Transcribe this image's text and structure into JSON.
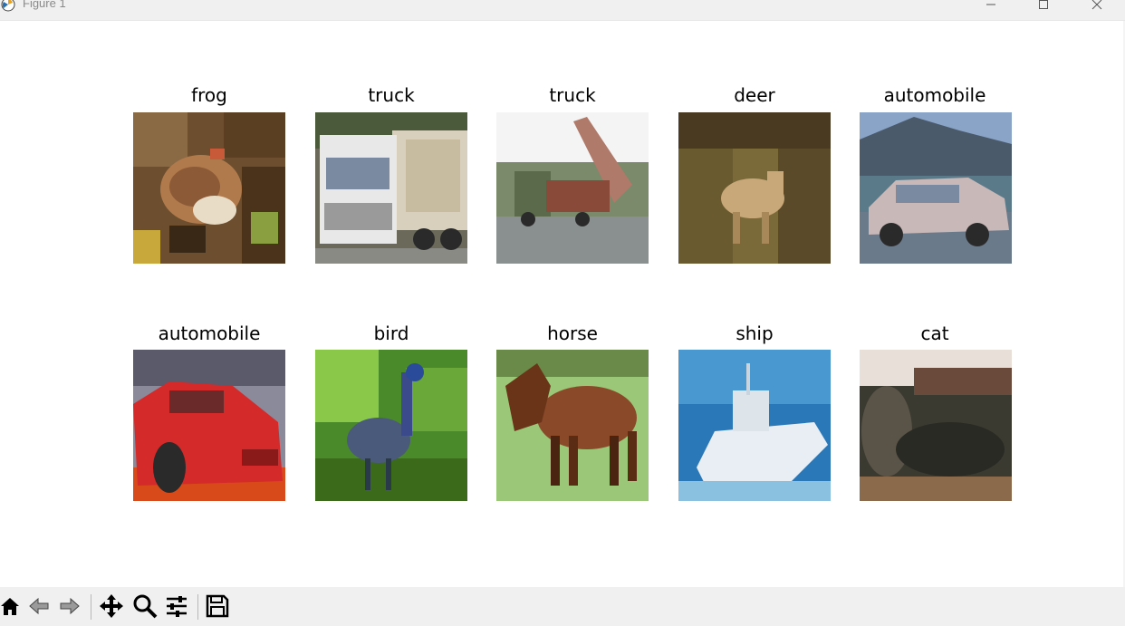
{
  "window": {
    "title": "Figure 1",
    "controls": [
      "minimize",
      "maximize",
      "close"
    ]
  },
  "figure": {
    "panels": [
      {
        "label": "frog"
      },
      {
        "label": "truck"
      },
      {
        "label": "truck"
      },
      {
        "label": "deer"
      },
      {
        "label": "automobile"
      },
      {
        "label": "automobile"
      },
      {
        "label": "bird"
      },
      {
        "label": "horse"
      },
      {
        "label": "ship"
      },
      {
        "label": "cat"
      }
    ]
  },
  "toolbar": {
    "tools": [
      "home-icon",
      "back-arrow-icon",
      "forward-arrow-icon",
      "pan-icon",
      "zoom-icon",
      "configure-subplots-icon",
      "save-icon"
    ]
  }
}
